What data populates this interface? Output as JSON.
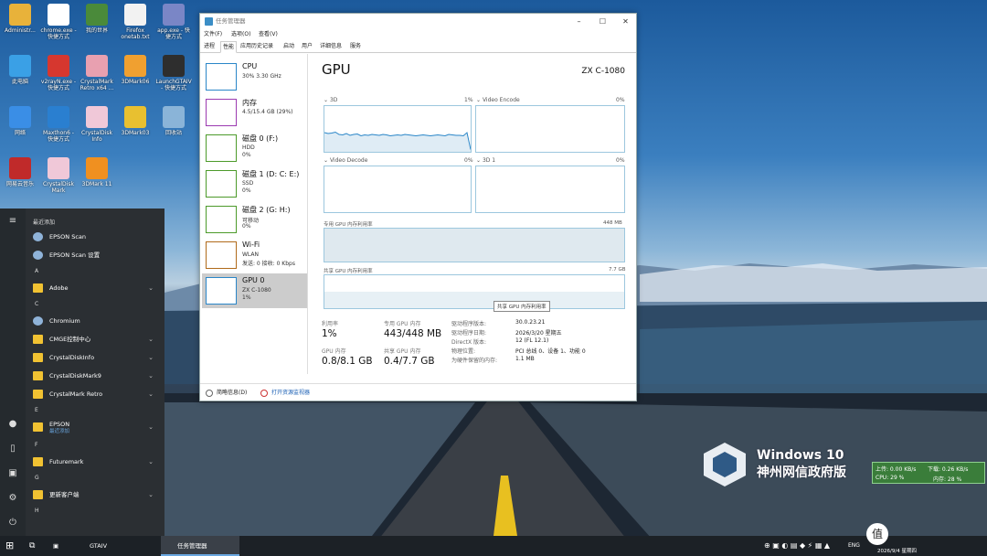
{
  "desktop": {
    "icons": [
      {
        "label": "Administr...",
        "color": "#e8b23a"
      },
      {
        "label": "chrome.exe - 快捷方式",
        "color": "#ffffff"
      },
      {
        "label": "我的世界",
        "color": "#4a8a3a"
      },
      {
        "label": "Firefox onetab.txt",
        "color": "#f2f2f2"
      },
      {
        "label": "app.exe - 快捷方式",
        "color": "#7a86c6"
      },
      {
        "label": "此电脑",
        "color": "#3aa0e6"
      },
      {
        "label": "v2rayN.exe - 快捷方式",
        "color": "#d6372f"
      },
      {
        "label": "CrystalMark Retro x64 ...",
        "color": "#e8a0b0"
      },
      {
        "label": "3DMark06",
        "color": "#f0a030"
      },
      {
        "label": "LaunchGTAIV - 快捷方式",
        "color": "#2e2e2e"
      },
      {
        "label": "网络",
        "color": "#3a8ee6"
      },
      {
        "label": "Maxthon6 - 快捷方式",
        "color": "#2a7fd0"
      },
      {
        "label": "CrystalDisk Info",
        "color": "#f0c8d8"
      },
      {
        "label": "3DMark03",
        "color": "#e8c030"
      },
      {
        "label": "回收站",
        "color": "#8ab4d8"
      },
      {
        "label": "网易云音乐",
        "color": "#c02a2a"
      },
      {
        "label": "CrystalDisk Mark",
        "color": "#f0c8d8"
      },
      {
        "label": "3DMark 11",
        "color": "#f09020"
      }
    ]
  },
  "start_menu": {
    "recent_header": "最近添加",
    "items": [
      {
        "type": "app",
        "label": "EPSON Scan",
        "chev": ""
      },
      {
        "type": "app",
        "label": "EPSON Scan 设置",
        "chev": ""
      },
      {
        "type": "header",
        "label": "A"
      },
      {
        "type": "folder",
        "label": "Adobe",
        "chev": "⌄"
      },
      {
        "type": "header",
        "label": "C"
      },
      {
        "type": "app",
        "label": "Chromium",
        "chev": ""
      },
      {
        "type": "folder",
        "label": "CMGE控制中心",
        "chev": "⌄"
      },
      {
        "type": "folder",
        "label": "CrystalDiskInfo",
        "chev": "⌄"
      },
      {
        "type": "folder",
        "label": "CrystalDiskMark9",
        "chev": "⌄"
      },
      {
        "type": "folder",
        "label": "CrystalMark Retro",
        "chev": "⌄"
      },
      {
        "type": "header",
        "label": "E"
      },
      {
        "type": "folder",
        "label": "EPSON",
        "sub": "最近添加",
        "chev": "⌄"
      },
      {
        "type": "header",
        "label": "F"
      },
      {
        "type": "folder",
        "label": "Futuremark",
        "chev": "⌄"
      },
      {
        "type": "header",
        "label": "G"
      },
      {
        "type": "folder",
        "label": "更新客户端",
        "chev": "⌄"
      },
      {
        "type": "header",
        "label": "H"
      }
    ]
  },
  "taskbar": {
    "items": [
      {
        "label": "GTAIV"
      },
      {
        "label": "任务管理器"
      }
    ],
    "tray": {
      "lang": "ENG",
      "date": "2026/9/4 星期四"
    }
  },
  "task_manager": {
    "title": "任务管理器",
    "menus": [
      "文件(F)",
      "选项(O)",
      "查看(V)"
    ],
    "tabs": [
      "进程",
      "性能",
      "应用历史记录",
      "启动",
      "用户",
      "详细信息",
      "服务"
    ],
    "active_tab": "性能",
    "resources": [
      {
        "name": "CPU",
        "line1": "30% 3.30 GHz",
        "line2": "",
        "color": "#2a86c8"
      },
      {
        "name": "内存",
        "line1": "4.5/15.4 GB (29%)",
        "line2": "",
        "color": "#9b3ab0"
      },
      {
        "name": "磁盘 0 (F:)",
        "line1": "HDD",
        "line2": "0%",
        "color": "#4c9a2a"
      },
      {
        "name": "磁盘 1 (D: C: E:)",
        "line1": "SSD",
        "line2": "0%",
        "color": "#4c9a2a"
      },
      {
        "name": "磁盘 2 (G: H:)",
        "line1": "可移动",
        "line2": "0%",
        "color": "#4c9a2a"
      },
      {
        "name": "Wi-Fi",
        "line1": "WLAN",
        "line2": "发送: 0 接收: 0 Kbps",
        "color": "#b06a1a"
      },
      {
        "name": "GPU 0",
        "line1": "ZX C-1080",
        "line2": "1%",
        "color": "#2a86c8",
        "selected": true
      }
    ],
    "gpu": {
      "title": "GPU",
      "model": "ZX C-1080",
      "engines": [
        {
          "name": "3D",
          "pct": "1%"
        },
        {
          "name": "Video Encode",
          "pct": "0%"
        },
        {
          "name": "Video Decode",
          "pct": "0%"
        },
        {
          "name": "3D 1",
          "pct": "0%"
        }
      ],
      "dedicated_label": "专用 GPU 内存利用率",
      "dedicated_max": "448 MB",
      "shared_label": "共享 GPU 内存利用率",
      "shared_max": "7.7 GB",
      "tooltip": "共享 GPU 内存利用率",
      "stats": [
        {
          "label": "利用率",
          "value": "1%"
        },
        {
          "label": "专用 GPU 内存",
          "value": "443/448 MB"
        },
        {
          "label": "GPU 内存",
          "value": "0.8/8.1 GB"
        },
        {
          "label": "共享 GPU 内存",
          "value": "0.4/7.7 GB"
        }
      ],
      "details": [
        {
          "k": "驱动程序版本:",
          "v": "30.0.23.21"
        },
        {
          "k": "驱动程序日期:",
          "v": "2026/3/20 星期五"
        },
        {
          "k": "DirectX 版本:",
          "v": "12 (FL 12.1)"
        },
        {
          "k": "物理位置:",
          "v": "PCI 总线 0、设备 1、功能 0"
        },
        {
          "k": "为硬件保留的内存:",
          "v": "1.1 MB"
        }
      ],
      "util_3d": [
        0.42,
        0.4,
        0.41,
        0.43,
        0.38,
        0.37,
        0.4,
        0.36,
        0.38,
        0.39,
        0.35,
        0.37,
        0.36,
        0.38,
        0.37,
        0.36,
        0.38,
        0.37,
        0.35,
        0.36,
        0.37,
        0.36,
        0.38,
        0.37,
        0.36,
        0.35,
        0.36,
        0.37,
        0.36,
        0.35,
        0.36,
        0.37,
        0.36,
        0.35,
        0.38,
        0.37,
        0.36,
        0.36,
        0.35,
        0.42,
        0.05
      ]
    },
    "footer": {
      "less": "简略信息(D)",
      "monitor": "打开资源监视器"
    }
  },
  "watermark": {
    "line1": "Windows 10",
    "line2": "神州网信政府版"
  },
  "net_widget": {
    "up": "上传: 0.00 KB/s",
    "down": "下载: 0.26 KB/s",
    "cpu": "CPU: 29 %",
    "mem": "内存: 28 %"
  }
}
